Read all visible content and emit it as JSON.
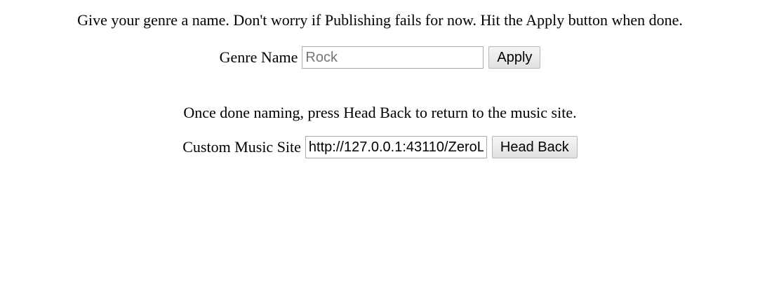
{
  "instructions": {
    "genre": "Give your genre a name. Don't worry if Publishing fails for now. Hit the Apply button when done.",
    "return": "Once done naming, press Head Back to return to the music site."
  },
  "genre_form": {
    "label": "Genre Name",
    "placeholder": "Rock",
    "value": "",
    "apply_label": "Apply"
  },
  "site_form": {
    "label": "Custom Music Site",
    "value": "http://127.0.0.1:43110/ZeroL",
    "head_back_label": "Head Back"
  }
}
